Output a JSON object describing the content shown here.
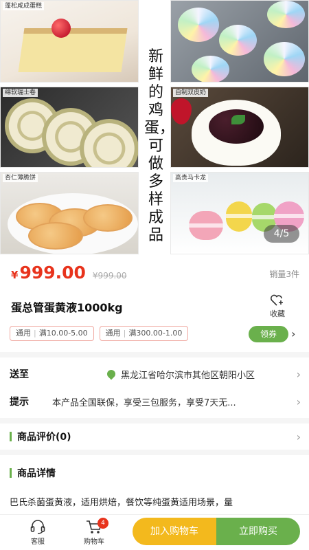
{
  "gallery": {
    "captions": [
      "蓬松咸成蛋糕",
      "",
      "绵软瑞士卷",
      "自制双皮奶",
      "杏仁薄脆饼",
      "高贵马卡龙"
    ],
    "headline": "新鲜的鸡蛋，可做多样成品",
    "pager": "4/5"
  },
  "product": {
    "currency": "¥",
    "price": "999.00",
    "original_price": "¥999.00",
    "sales": "销量3件",
    "title": "蛋总管蛋黄液1000kg",
    "favorite_label": "收藏",
    "coupons": [
      {
        "tag": "通用",
        "text": "满10.00-5.00"
      },
      {
        "tag": "通用",
        "text": "满300.00-1.00"
      }
    ],
    "coupon_button": "领券"
  },
  "shipping": {
    "label": "送至",
    "address": "黑龙江省哈尔滨市其他区朝阳小区"
  },
  "notice": {
    "label": "提示",
    "text": "本产品全国联保，享受三包服务，享受7天无..."
  },
  "reviews": {
    "title": "商品评价(0)"
  },
  "details": {
    "title": "商品详情",
    "text": "巴氏杀菌蛋黄液，适用烘焙，餐饮等纯蛋黄适用场景，量"
  },
  "bottom_bar": {
    "service_label": "客服",
    "cart_label": "购物车",
    "cart_count": "4",
    "add_to_cart": "加入购物车",
    "buy_now": "立即购买"
  },
  "colors": {
    "price": "#e8331c",
    "accent_green": "#6ab04c",
    "accent_yellow": "#f3b91d"
  }
}
